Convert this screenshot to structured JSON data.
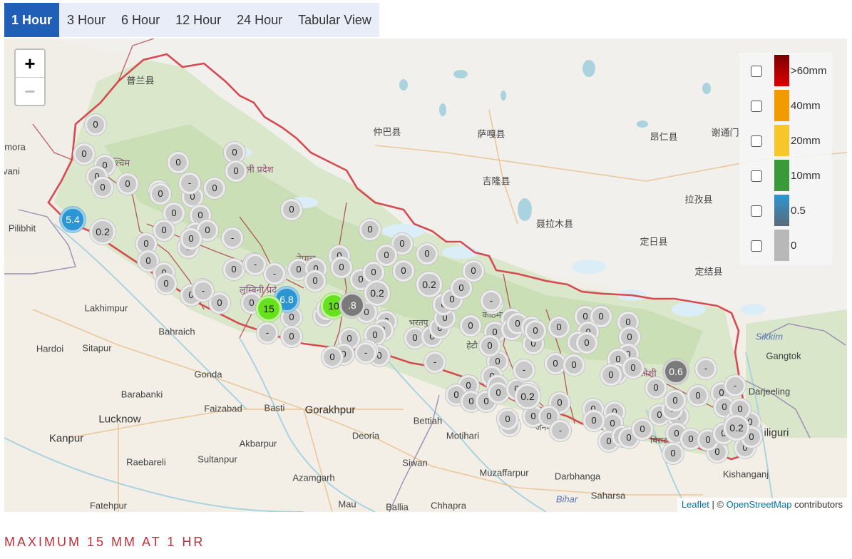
{
  "tabs": [
    {
      "label": "1 Hour",
      "active": true
    },
    {
      "label": "3 Hour",
      "active": false
    },
    {
      "label": "6 Hour",
      "active": false
    },
    {
      "label": "12 Hour",
      "active": false
    },
    {
      "label": "24 Hour",
      "active": false
    },
    {
      "label": "Tabular View",
      "active": false
    }
  ],
  "zoom": {
    "in_label": "+",
    "out_label": "−"
  },
  "legend": [
    {
      "label": ">60mm",
      "color": "#c00000"
    },
    {
      "label": "40mm",
      "color": "#f29b00"
    },
    {
      "label": "20mm",
      "color": "#f6c62a"
    },
    {
      "label": "10mm",
      "color": "#3a9a3a"
    },
    {
      "label": "0.5",
      "color": "#2b96d3"
    },
    {
      "label": "0",
      "color": "#b8b8b8"
    }
  ],
  "places": {
    "lakhimpur": "Lakhimpur",
    "bahraich": "Bahraich",
    "hardoi": "Hardoi",
    "sitapur": "Sitapur",
    "gonda": "Gonda",
    "barabanki": "Barabanki",
    "lucknow": "Lucknow",
    "faizabad": "Faizabad",
    "basti": "Basti",
    "gorakhpur": "Gorakhpur",
    "kanpur": "Kanpur",
    "akbarpur": "Akbarpur",
    "raebareli": "Raebareli",
    "sultanpur": "Sultanpur",
    "azamgarh": "Azamgarh",
    "fatehpur": "Fatehpur",
    "mau": "Mau",
    "ballia": "Ballia",
    "chhapra": "Chhapra",
    "siwan": "Siwan",
    "deoria": "Deoria",
    "bettiah": "Bettiah",
    "motihari": "Motihari",
    "muzaffarpur": "Muzaffarpur",
    "darbhanga": "Darbhanga",
    "saharsa": "Saharsa",
    "bihar": "Bihar",
    "pilibhit": "Pilibhit",
    "mora": "mora",
    "vani": "vani",
    "gangtok": "Gangtok",
    "darjeeling": "Darjeeling",
    "siliguri": "iliguri",
    "kishanganj": "Kishanganj",
    "sikkim": "Sikkim",
    "cn1": "普兰县",
    "cn2": "仲巴县",
    "cn3": "萨嘎县",
    "cn4": "吉隆县",
    "cn5": "聂拉木县",
    "cn6": "定日县",
    "cn7": "拉孜县",
    "cn8": "昂仁县",
    "cn9": "谢通门",
    "cn10": "定结县",
    "np1": "पश्चिम",
    "np2": "ली प्रदेश",
    "np3": "लुम्बिनी प्रदे",
    "np4": "कोशी",
    "np5": "नेपाल",
    "np6": "भरतपु",
    "np7": "काठमाडौं",
    "np8": "हेटौ",
    "np9": "बिराट",
    "np10": "जनक"
  },
  "markers": [
    {
      "v": "5.4",
      "c": "blue"
    },
    {
      "v": "0.2",
      "c": "grey"
    },
    {
      "v": "6.8",
      "c": "blue"
    },
    {
      "v": "15",
      "c": "green"
    },
    {
      "v": "10",
      "c": "green"
    },
    {
      "v": ".8",
      "c": "dark"
    },
    {
      "v": "0.2",
      "c": "grey"
    },
    {
      "v": "0.2",
      "c": "grey"
    },
    {
      "v": "0.2",
      "c": "grey"
    },
    {
      "v": "0.6",
      "c": "dark"
    },
    {
      "v": "0.2",
      "c": "grey"
    },
    {
      "v": "0",
      "c": "grey"
    },
    {
      "v": "-",
      "c": "grey"
    }
  ],
  "attribution": {
    "leaflet": "Leaflet",
    "sep": " | © ",
    "osm": "OpenStreetMap",
    "rest": " contributors"
  },
  "footer": {
    "note": "MAXIMUM 15 MM AT 1 HR"
  }
}
